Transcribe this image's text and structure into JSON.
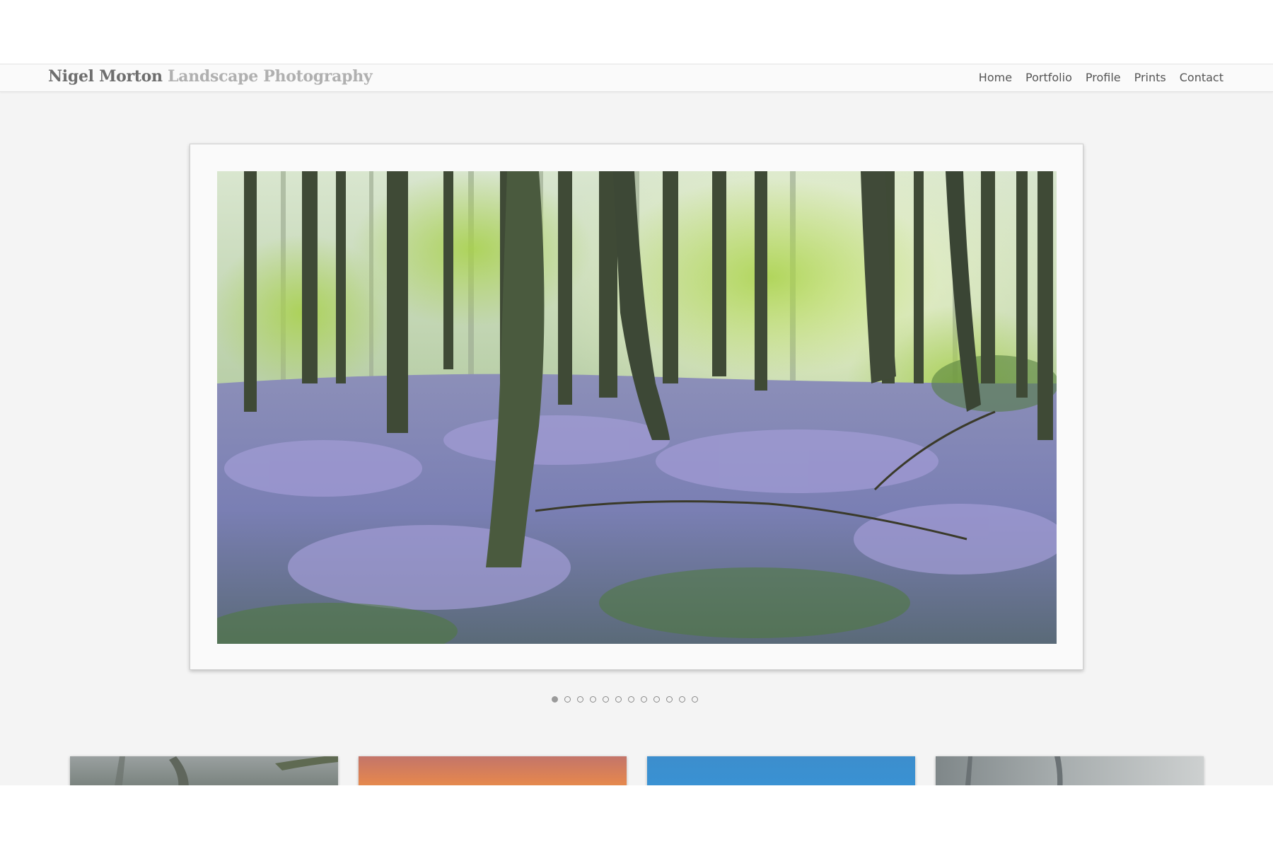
{
  "header": {
    "brand_name": "Nigel Morton",
    "brand_tagline": "Landscape Photography",
    "nav": [
      "Home",
      "Portfolio",
      "Profile",
      "Prints",
      "Contact"
    ]
  },
  "slideshow": {
    "image": "bluebell-woodland-photo",
    "slide_count": 12,
    "active_slide": 1
  },
  "thumbnails": [
    "misty-woodland-thumbnail",
    "sunset-sky-thumbnail",
    "blue-sky-thumbnail",
    "misty-trees-thumbnail"
  ],
  "colors": {
    "background": "#f4f4f4",
    "nav_text": "#555555",
    "brand_name": "#6e6e6e",
    "brand_tagline": "#b0b0b0"
  }
}
